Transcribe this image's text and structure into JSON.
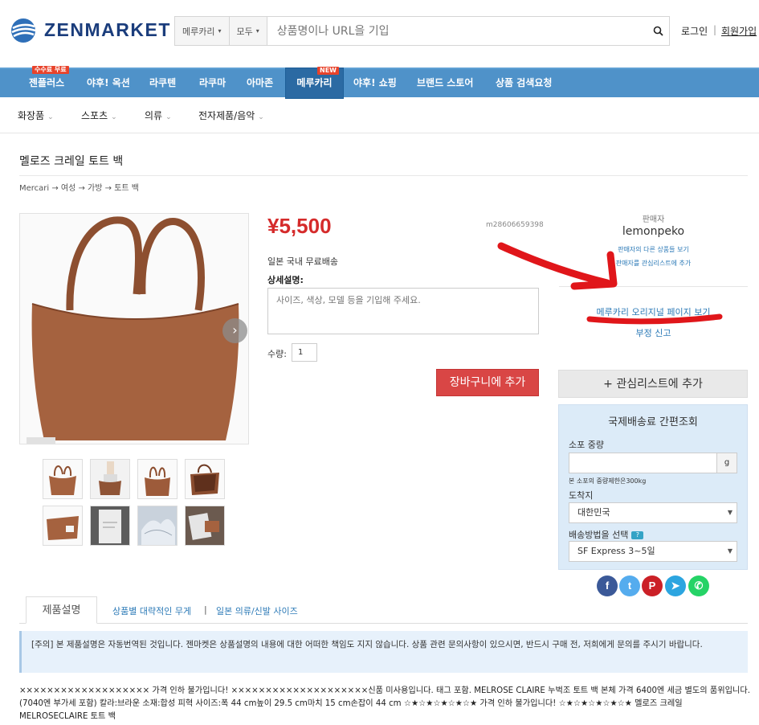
{
  "header": {
    "logo_text": "ZENMARKET",
    "search": {
      "site_select": "메루카리",
      "category_select": "모두",
      "placeholder": "상품명이나 URL을 기입"
    },
    "login": "로그인",
    "separator": "|",
    "signup": "회원가입"
  },
  "nav": {
    "items": [
      {
        "label": "젠플러스",
        "tag": "수수료 무료"
      },
      {
        "label": "야후! 옥션"
      },
      {
        "label": "라쿠텐"
      },
      {
        "label": "라쿠마"
      },
      {
        "label": "아마존"
      },
      {
        "label": "메루카리",
        "tag": "NEW",
        "active": true
      },
      {
        "label": "야후! 쇼핑"
      },
      {
        "label": "브랜드 스토어"
      },
      {
        "label": "상품 검색요청"
      }
    ]
  },
  "subnav": {
    "items": [
      "화장품",
      "스포츠",
      "의류",
      "전자제품/음악"
    ]
  },
  "product": {
    "title": "멜로즈 크레일 토트 백",
    "breadcrumb": "Mercari → 여성 → 가방 → 토트 백",
    "price": "¥5,500",
    "item_id": "m28606659398",
    "shipping": "일본 국내 무료배송",
    "desc_label": "상세설명:",
    "desc_placeholder": "사이즈, 색상, 모델 등을 기입해 주세요.",
    "qty_label": "수량:",
    "qty_value": "1",
    "cart_button": "장바구니에 추가"
  },
  "seller": {
    "label": "판매자",
    "name": "lemonpeko",
    "other_items": "판매자의 다른 상품들 보기",
    "add_watch": "판매자를 관심리스트에 추가",
    "original_page": "메루카리 오리지널 페이지 보기",
    "report": "부정 신고",
    "wishlist_button": "+ 관심리스트에 추가"
  },
  "shipping_calc": {
    "title": "국제배송료 간편조회",
    "weight_label": "소포 중량",
    "weight_unit": "g",
    "weight_note": "본 소포의 중량제한은300kg",
    "dest_label": "도착지",
    "dest_value": "대한민국",
    "method_label": "배송방법을 선택",
    "help_badge": "?",
    "method_value": "SF Express 3~5일"
  },
  "tabs": {
    "product_desc": "제품설명",
    "weight": "상품별 대략적인 무게",
    "separator": "|",
    "size": "일본 의류/신발 사이즈"
  },
  "notice": "[주의] 본 제품설명은 자동번역된 것입니다. 젠마켓은 상품설명의 내용에 대한 어떠한 책임도 지지 않습니다. 상품 관련 문의사항이 있으시면, 반드시 구매 전, 저희에게 문의를 주시기 바랍니다.",
  "description": "××××××××××××××××××× 가격 인하 불가입니다! ××××××××××××××××××××신품 미사용입니다. 태그 포함. MELROSE CLAIRE 누벅조 토트 백 본체 가격 6400엔 세금 별도의 품위입니다. (7040엔 부가세 포함) 칼라:브라운 소재:합성 피혁 사이즈:폭 44 cm높이 29.5 cm마치 15 cm손잡이 44 cm ☆★☆★☆★☆★☆★ 가격 인하 불가입니다! ☆★☆★☆★☆★☆★ 멜로즈 크레일 MELROSECLAIRE 토트 백",
  "colors": {
    "brand_blue": "#1b3d7c",
    "nav_blue": "#4f92c9",
    "price_red": "#d52b2b",
    "cart_red": "#d94645",
    "link_blue": "#2c7ab7",
    "annotation_red": "#e0161a",
    "bag_brown": "#a5623f"
  }
}
